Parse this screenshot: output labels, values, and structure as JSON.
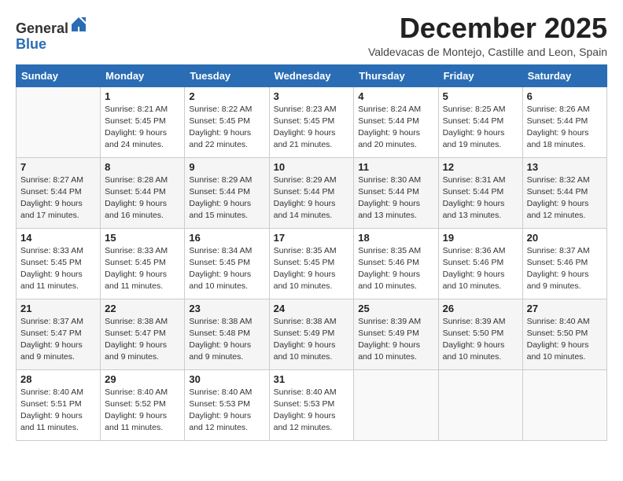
{
  "logo": {
    "general": "General",
    "blue": "Blue"
  },
  "title": "December 2025",
  "subtitle": "Valdevacas de Montejo, Castille and Leon, Spain",
  "weekdays": [
    "Sunday",
    "Monday",
    "Tuesday",
    "Wednesday",
    "Thursday",
    "Friday",
    "Saturday"
  ],
  "weeks": [
    [
      {
        "day": "",
        "sunrise": "",
        "sunset": "",
        "daylight": ""
      },
      {
        "day": "1",
        "sunrise": "Sunrise: 8:21 AM",
        "sunset": "Sunset: 5:45 PM",
        "daylight": "Daylight: 9 hours and 24 minutes."
      },
      {
        "day": "2",
        "sunrise": "Sunrise: 8:22 AM",
        "sunset": "Sunset: 5:45 PM",
        "daylight": "Daylight: 9 hours and 22 minutes."
      },
      {
        "day": "3",
        "sunrise": "Sunrise: 8:23 AM",
        "sunset": "Sunset: 5:45 PM",
        "daylight": "Daylight: 9 hours and 21 minutes."
      },
      {
        "day": "4",
        "sunrise": "Sunrise: 8:24 AM",
        "sunset": "Sunset: 5:44 PM",
        "daylight": "Daylight: 9 hours and 20 minutes."
      },
      {
        "day": "5",
        "sunrise": "Sunrise: 8:25 AM",
        "sunset": "Sunset: 5:44 PM",
        "daylight": "Daylight: 9 hours and 19 minutes."
      },
      {
        "day": "6",
        "sunrise": "Sunrise: 8:26 AM",
        "sunset": "Sunset: 5:44 PM",
        "daylight": "Daylight: 9 hours and 18 minutes."
      }
    ],
    [
      {
        "day": "7",
        "sunrise": "Sunrise: 8:27 AM",
        "sunset": "Sunset: 5:44 PM",
        "daylight": "Daylight: 9 hours and 17 minutes."
      },
      {
        "day": "8",
        "sunrise": "Sunrise: 8:28 AM",
        "sunset": "Sunset: 5:44 PM",
        "daylight": "Daylight: 9 hours and 16 minutes."
      },
      {
        "day": "9",
        "sunrise": "Sunrise: 8:29 AM",
        "sunset": "Sunset: 5:44 PM",
        "daylight": "Daylight: 9 hours and 15 minutes."
      },
      {
        "day": "10",
        "sunrise": "Sunrise: 8:29 AM",
        "sunset": "Sunset: 5:44 PM",
        "daylight": "Daylight: 9 hours and 14 minutes."
      },
      {
        "day": "11",
        "sunrise": "Sunrise: 8:30 AM",
        "sunset": "Sunset: 5:44 PM",
        "daylight": "Daylight: 9 hours and 13 minutes."
      },
      {
        "day": "12",
        "sunrise": "Sunrise: 8:31 AM",
        "sunset": "Sunset: 5:44 PM",
        "daylight": "Daylight: 9 hours and 13 minutes."
      },
      {
        "day": "13",
        "sunrise": "Sunrise: 8:32 AM",
        "sunset": "Sunset: 5:44 PM",
        "daylight": "Daylight: 9 hours and 12 minutes."
      }
    ],
    [
      {
        "day": "14",
        "sunrise": "Sunrise: 8:33 AM",
        "sunset": "Sunset: 5:45 PM",
        "daylight": "Daylight: 9 hours and 11 minutes."
      },
      {
        "day": "15",
        "sunrise": "Sunrise: 8:33 AM",
        "sunset": "Sunset: 5:45 PM",
        "daylight": "Daylight: 9 hours and 11 minutes."
      },
      {
        "day": "16",
        "sunrise": "Sunrise: 8:34 AM",
        "sunset": "Sunset: 5:45 PM",
        "daylight": "Daylight: 9 hours and 10 minutes."
      },
      {
        "day": "17",
        "sunrise": "Sunrise: 8:35 AM",
        "sunset": "Sunset: 5:45 PM",
        "daylight": "Daylight: 9 hours and 10 minutes."
      },
      {
        "day": "18",
        "sunrise": "Sunrise: 8:35 AM",
        "sunset": "Sunset: 5:46 PM",
        "daylight": "Daylight: 9 hours and 10 minutes."
      },
      {
        "day": "19",
        "sunrise": "Sunrise: 8:36 AM",
        "sunset": "Sunset: 5:46 PM",
        "daylight": "Daylight: 9 hours and 10 minutes."
      },
      {
        "day": "20",
        "sunrise": "Sunrise: 8:37 AM",
        "sunset": "Sunset: 5:46 PM",
        "daylight": "Daylight: 9 hours and 9 minutes."
      }
    ],
    [
      {
        "day": "21",
        "sunrise": "Sunrise: 8:37 AM",
        "sunset": "Sunset: 5:47 PM",
        "daylight": "Daylight: 9 hours and 9 minutes."
      },
      {
        "day": "22",
        "sunrise": "Sunrise: 8:38 AM",
        "sunset": "Sunset: 5:47 PM",
        "daylight": "Daylight: 9 hours and 9 minutes."
      },
      {
        "day": "23",
        "sunrise": "Sunrise: 8:38 AM",
        "sunset": "Sunset: 5:48 PM",
        "daylight": "Daylight: 9 hours and 9 minutes."
      },
      {
        "day": "24",
        "sunrise": "Sunrise: 8:38 AM",
        "sunset": "Sunset: 5:49 PM",
        "daylight": "Daylight: 9 hours and 10 minutes."
      },
      {
        "day": "25",
        "sunrise": "Sunrise: 8:39 AM",
        "sunset": "Sunset: 5:49 PM",
        "daylight": "Daylight: 9 hours and 10 minutes."
      },
      {
        "day": "26",
        "sunrise": "Sunrise: 8:39 AM",
        "sunset": "Sunset: 5:50 PM",
        "daylight": "Daylight: 9 hours and 10 minutes."
      },
      {
        "day": "27",
        "sunrise": "Sunrise: 8:40 AM",
        "sunset": "Sunset: 5:50 PM",
        "daylight": "Daylight: 9 hours and 10 minutes."
      }
    ],
    [
      {
        "day": "28",
        "sunrise": "Sunrise: 8:40 AM",
        "sunset": "Sunset: 5:51 PM",
        "daylight": "Daylight: 9 hours and 11 minutes."
      },
      {
        "day": "29",
        "sunrise": "Sunrise: 8:40 AM",
        "sunset": "Sunset: 5:52 PM",
        "daylight": "Daylight: 9 hours and 11 minutes."
      },
      {
        "day": "30",
        "sunrise": "Sunrise: 8:40 AM",
        "sunset": "Sunset: 5:53 PM",
        "daylight": "Daylight: 9 hours and 12 minutes."
      },
      {
        "day": "31",
        "sunrise": "Sunrise: 8:40 AM",
        "sunset": "Sunset: 5:53 PM",
        "daylight": "Daylight: 9 hours and 12 minutes."
      },
      {
        "day": "",
        "sunrise": "",
        "sunset": "",
        "daylight": ""
      },
      {
        "day": "",
        "sunrise": "",
        "sunset": "",
        "daylight": ""
      },
      {
        "day": "",
        "sunrise": "",
        "sunset": "",
        "daylight": ""
      }
    ]
  ]
}
